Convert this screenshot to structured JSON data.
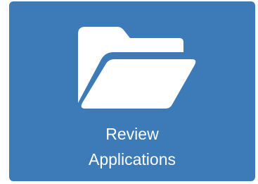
{
  "tile": {
    "label_line1": "Review",
    "label_line2": "Applications",
    "icon": "folder-open-icon",
    "background_color": "#3c7ab8",
    "foreground_color": "#ffffff"
  }
}
